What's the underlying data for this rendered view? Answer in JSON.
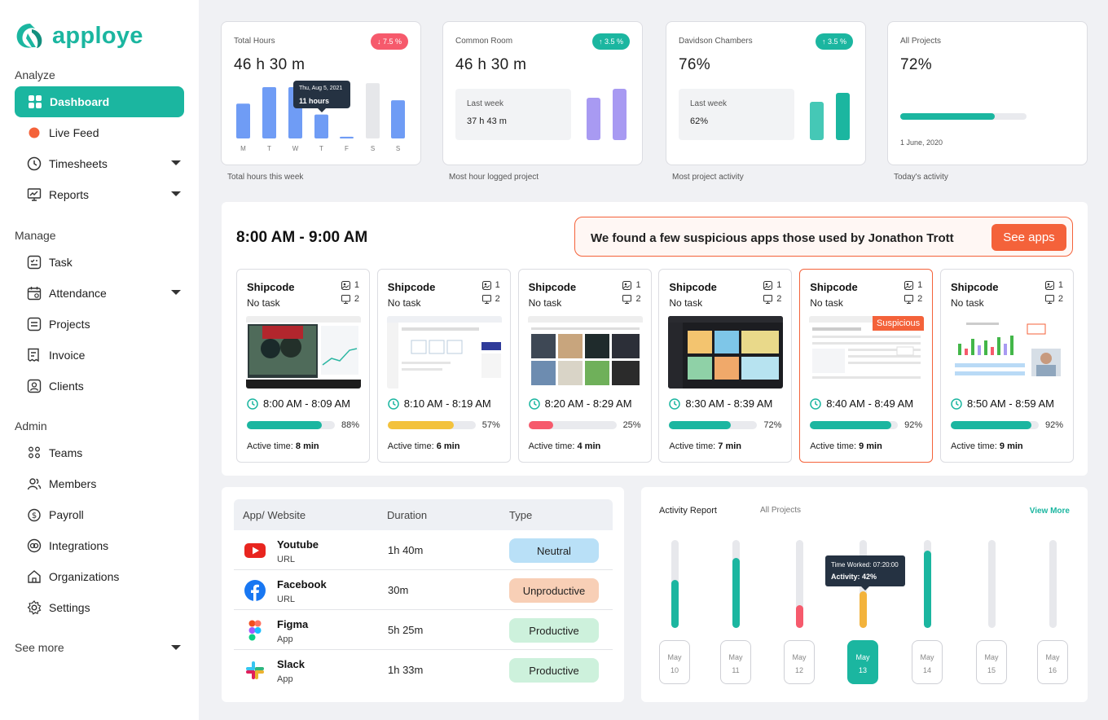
{
  "app": {
    "name": "apploye",
    "brand_color": "#1bb6a0"
  },
  "sidebar": {
    "sections": {
      "analyze": "Analyze",
      "manage": "Manage",
      "admin": "Admin"
    },
    "analyze_items": [
      {
        "label": "Dashboard",
        "icon": "dashboard-icon",
        "active": true
      },
      {
        "label": "Live Feed",
        "icon": "live-dot-icon"
      },
      {
        "label": "Timesheets",
        "icon": "clock-icon",
        "has_dropdown": true
      },
      {
        "label": "Reports",
        "icon": "reports-icon",
        "has_dropdown": true
      }
    ],
    "manage_items": [
      {
        "label": "Task",
        "icon": "task-icon"
      },
      {
        "label": "Attendance",
        "icon": "calendar-icon",
        "has_dropdown": true
      },
      {
        "label": "Projects",
        "icon": "projects-icon"
      },
      {
        "label": "Invoice",
        "icon": "invoice-icon"
      },
      {
        "label": "Clients",
        "icon": "clients-icon"
      }
    ],
    "admin_items": [
      {
        "label": "Teams",
        "icon": "teams-icon"
      },
      {
        "label": "Members",
        "icon": "members-icon"
      },
      {
        "label": "Payroll",
        "icon": "payroll-icon"
      },
      {
        "label": "Integrations",
        "icon": "integrations-icon"
      },
      {
        "label": "Organizations",
        "icon": "organizations-icon"
      },
      {
        "label": "Settings",
        "icon": "settings-icon"
      }
    ],
    "see_more": "See more"
  },
  "stats": {
    "total_hours": {
      "label": "Total Hours",
      "value": "46 h 30 m",
      "badge": "7.5 %",
      "trend": "down",
      "caption": "Total hours this week",
      "days": [
        "M",
        "T",
        "W",
        "T",
        "F",
        "S",
        "S"
      ],
      "day_values": [
        0.61,
        0.9,
        0.9,
        0.42,
        0.03,
        0.97,
        0.67
      ],
      "tooltip_date": "Thu, Aug 5, 2021",
      "tooltip_value": "11 hours"
    },
    "common_room": {
      "label": "Common Room",
      "value": "46 h 30 m",
      "badge": "3.5 %",
      "trend": "up",
      "last_week_label": "Last week",
      "last_week_value": "37 h 43 m",
      "caption": "Most hour logged project"
    },
    "davidson": {
      "label": "Davidson Chambers",
      "value": "76%",
      "badge": "3.5 %",
      "trend": "up",
      "last_week_label": "Last week",
      "last_week_value": "62%",
      "caption": "Most project activity"
    },
    "all_projects": {
      "label": "All Projects",
      "value": "72%",
      "progress": 0.75,
      "date": "1 June, 2020",
      "caption": "Today's activity"
    }
  },
  "screenshots": {
    "time_range": "8:00 AM - 9:00 AM",
    "alert_text": "We found a few suspicious apps those used by Jonathon Trott",
    "alert_button": "See apps",
    "suspicious_label": "Suspicious",
    "active_prefix": "Active time: ",
    "items": [
      {
        "app": "Shipcode",
        "task": "No task",
        "screenshots": "1",
        "screens": "2",
        "time": "8:00 AM - 8:09 AM",
        "pct": "88%",
        "fill": 0.85,
        "color": "#1bb6a0",
        "active": "8 min"
      },
      {
        "app": "Shipcode",
        "task": "No task",
        "screenshots": "1",
        "screens": "2",
        "time": "8:10 AM - 8:19 AM",
        "pct": "57%",
        "fill": 0.75,
        "color": "#f3c23c",
        "active": "6 min"
      },
      {
        "app": "Shipcode",
        "task": "No task",
        "screenshots": "1",
        "screens": "2",
        "time": "8:20 AM - 8:29 AM",
        "pct": "25%",
        "fill": 0.28,
        "color": "#f65a6c",
        "active": "4 min"
      },
      {
        "app": "Shipcode",
        "task": "No task",
        "screenshots": "1",
        "screens": "2",
        "time": "8:30 AM - 8:39 AM",
        "pct": "72%",
        "fill": 0.7,
        "color": "#1bb6a0",
        "active": "7 min"
      },
      {
        "app": "Shipcode",
        "task": "No task",
        "screenshots": "1",
        "screens": "2",
        "time": "8:40 AM - 8:49 AM",
        "pct": "92%",
        "fill": 0.92,
        "color": "#1bb6a0",
        "active": "9 min",
        "suspicious": true
      },
      {
        "app": "Shipcode",
        "task": "No task",
        "screenshots": "1",
        "screens": "2",
        "time": "8:50 AM - 8:59 AM",
        "pct": "92%",
        "fill": 0.92,
        "color": "#1bb6a0",
        "active": "9 min"
      }
    ]
  },
  "apps_table": {
    "headers": [
      "App/ Website",
      "Duration",
      "Type"
    ],
    "rows": [
      {
        "name": "Youtube",
        "kind": "URL",
        "duration": "1h 40m",
        "type": "Neutral",
        "type_color": "#b9e0f7",
        "icon": "youtube-icon"
      },
      {
        "name": "Facebook",
        "kind": "URL",
        "duration": "30m",
        "type": "Unproductive",
        "type_color": "#f8cfb6",
        "icon": "facebook-icon"
      },
      {
        "name": "Figma",
        "kind": "App",
        "duration": "5h 25m",
        "type": "Productive",
        "type_color": "#cdf1dc",
        "icon": "figma-icon"
      },
      {
        "name": "Slack",
        "kind": "App",
        "duration": "1h 33m",
        "type": "Productive",
        "type_color": "#cdf1dc",
        "icon": "slack-icon"
      }
    ]
  },
  "activity_report": {
    "title": "Activity Report",
    "filter": "All Projects",
    "view_more": "View More",
    "tooltip_time": "Time Worked: 07:20:00",
    "tooltip_activity": "Activity: 42%",
    "days": [
      {
        "month": "May",
        "day": "10",
        "value": 0.55,
        "color": "#1bb6a0"
      },
      {
        "month": "May",
        "day": "11",
        "value": 0.8,
        "color": "#1bb6a0"
      },
      {
        "month": "May",
        "day": "12",
        "value": 0.26,
        "color": "#f65a6c"
      },
      {
        "month": "May",
        "day": "13",
        "value": 0.42,
        "color": "#f3b33c",
        "selected": true
      },
      {
        "month": "May",
        "day": "14",
        "value": 0.88,
        "color": "#1bb6a0"
      },
      {
        "month": "May",
        "day": "15",
        "value": 0,
        "color": "#1bb6a0"
      },
      {
        "month": "May",
        "day": "16",
        "value": 0,
        "color": "#1bb6a0"
      }
    ]
  },
  "colors": {
    "green": "#1bb6a0",
    "red": "#f65a6c",
    "orange": "#f4623a",
    "yellow": "#f3c23c",
    "blue": "#6f9cf5",
    "purple": "#a89af2",
    "navy": "#253242"
  }
}
